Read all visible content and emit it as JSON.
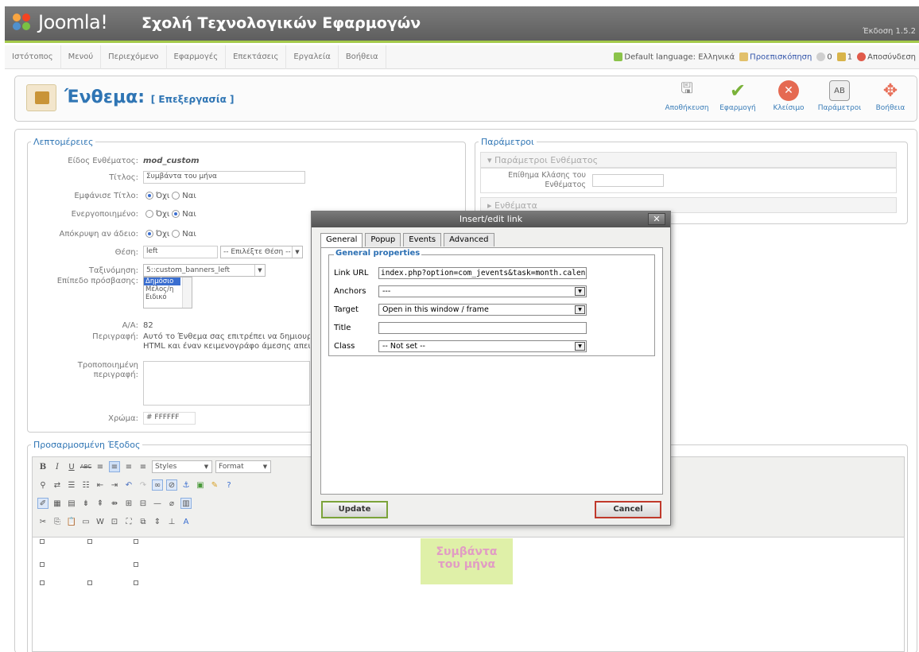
{
  "header": {
    "logo_text": "Joomla!",
    "site_name": "Σχολή Τεχνολογικών Εφαρμογών",
    "version": "Έκδοση 1.5.2"
  },
  "menubar": {
    "items": [
      "Ιστότοπος",
      "Μενού",
      "Περιεχόμενο",
      "Εφαρμογές",
      "Επεκτάσεις",
      "Εργαλεία",
      "Βοήθεια"
    ],
    "language_label": "Default language: Ελληνικά",
    "preview_label": "Προεπισκόπηση",
    "messages_count": "0",
    "users_count": "1",
    "logout_label": "Αποσύνδεση"
  },
  "toolbar": {
    "title": "Ένθεμα:",
    "subtitle": "[ Επεξεργασία ]",
    "buttons": {
      "save": "Αποθήκευση",
      "apply": "Εφαρμογή",
      "close": "Κλείσιμο",
      "params": "Παράμετροι",
      "help": "Βοήθεια"
    }
  },
  "details": {
    "legend": "Λεπτομέρειες",
    "module_type_label": "Είδος Ενθέματος:",
    "module_type_value": "mod_custom",
    "title_label": "Τίτλος:",
    "title_value": "Συμβάντα του μήνα",
    "show_title_label": "Εμφάνισε Τίτλο:",
    "enabled_label": "Ενεργοποιημένο:",
    "hide_empty_label": "Απόκρυψη αν άδειο:",
    "no_label": "Όχι",
    "yes_label": "Ναι",
    "position_label": "Θέση:",
    "position_value": "left",
    "position_select": "-- Επιλέξτε Θέση --",
    "order_label": "Ταξινόμηση:",
    "order_value": "5::custom_banners_left",
    "access_label": "Επίπεδο πρόσβασης:",
    "access_options": [
      "Δημόσιο",
      "Μέλος/η",
      "Ειδικό"
    ],
    "id_label": "Α/Α:",
    "id_value": "82",
    "description_label": "Περιγραφή:",
    "description_line1": "Αυτό το Ένθεμα σας επιτρέπει να δημιουργεί",
    "description_line2": "HTML και έναν κειμενογράφο άμεσης απεικόν",
    "custom_desc_label1": "Τροποποιημένη",
    "custom_desc_label2": "περιγραφή:",
    "color_label": "Χρώμα:",
    "color_value": "# FFFFFF"
  },
  "params": {
    "legend": "Παράμετροι",
    "module_params_header": "Παράμετροι Ενθέματος",
    "class_suffix_label1": "Επίθημα Κλάσης του",
    "class_suffix_label2": "Ενθέματος",
    "modules_header": "Ενθέματα"
  },
  "output": {
    "legend": "Προσαρμοσμένη Έξοδος",
    "styles_label": "Styles",
    "format_label": "Format",
    "event_box_line1": "Συμβάντα",
    "event_box_line2": "του μήνα"
  },
  "dialog": {
    "title": "Insert/edit link",
    "close_glyph": "✕",
    "tabs": [
      "General",
      "Popup",
      "Events",
      "Advanced"
    ],
    "legend": "General properties",
    "link_url_label": "Link URL",
    "link_url_value": "index.php?option=com_jevents&task=month.calen",
    "anchors_label": "Anchors",
    "anchors_value": "---",
    "target_label": "Target",
    "target_value": "Open in this window / frame",
    "title_label": "Title",
    "title_value": "",
    "class_label": "Class",
    "class_value": "-- Not set --",
    "update_label": "Update",
    "cancel_label": "Cancel"
  },
  "colors": {
    "header_bg": "#5e5e5e",
    "accent_green": "#a4c94a",
    "link_blue": "#2f75b4",
    "event_box_bg": "#dff0a8",
    "event_box_text": "#e19cc4"
  }
}
